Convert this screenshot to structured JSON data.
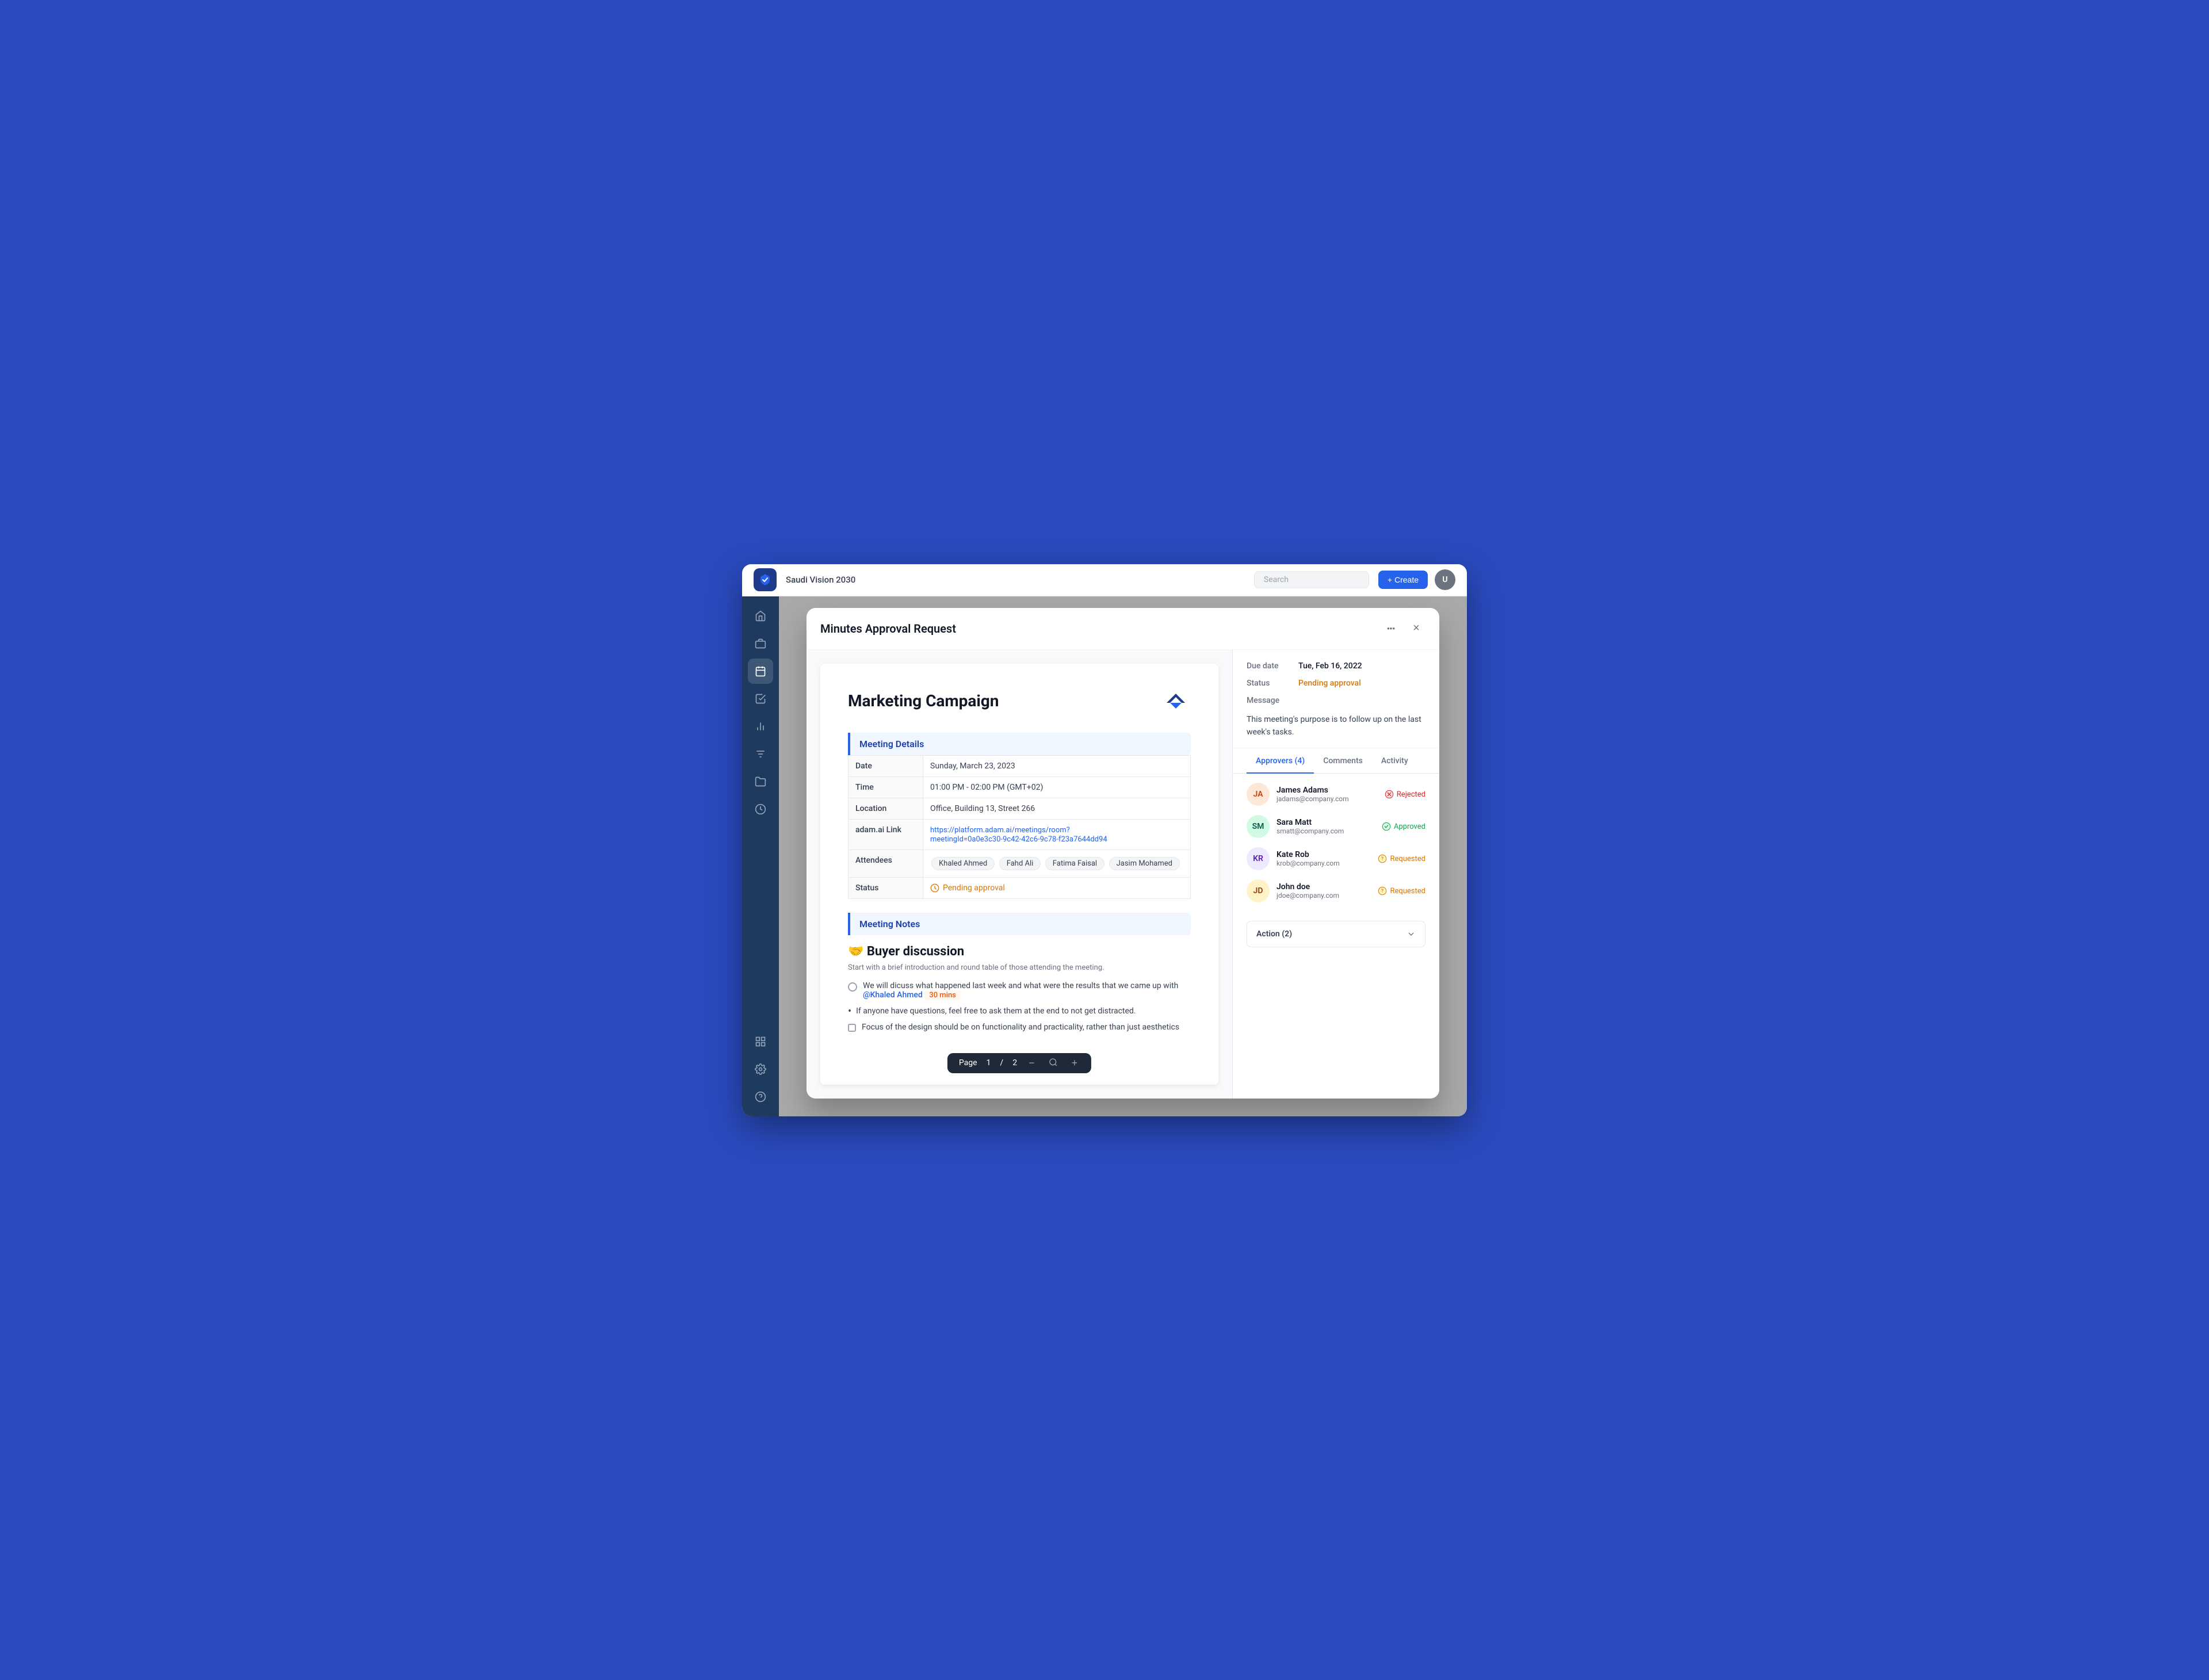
{
  "topbar": {
    "title": "Saudi Vision 2030",
    "search_placeholder": "Search",
    "create_label": "+ Create"
  },
  "modal": {
    "title": "Minutes Approval Request",
    "close_label": "×"
  },
  "document": {
    "title": "Marketing Campaign",
    "section_meeting_details": "Meeting Details",
    "fields": [
      {
        "label": "Date",
        "value": "Sunday, March 23, 2023"
      },
      {
        "label": "Time",
        "value": "01:00 PM - 02:00 PM (GMT+02)"
      },
      {
        "label": "Location",
        "value": "Office, Building 13, Street 266"
      },
      {
        "label": "adam.ai Link",
        "value": "https://platform.adam.ai/meetings/room?meetingId=0a0e3c30-9c42-42c6-9c78-f23a7644dd94",
        "is_link": true
      },
      {
        "label": "Attendees",
        "value": "",
        "is_attendees": true
      },
      {
        "label": "Status",
        "value": "Pending approval",
        "is_status": true
      }
    ],
    "attendees": [
      "Khaled Ahmed",
      "Fahd Ali",
      "Fatima Faisal",
      "Jasim Mohamed"
    ],
    "section_notes": "Meeting Notes",
    "notes_heading": "🤝 Buyer discussion",
    "notes_subtitle": "Start with a brief introduction and round table of those attending the meeting.",
    "tasks": [
      {
        "type": "circle",
        "text": "We will dicuss what happened last week and what were the results that we came up with",
        "mention": "@Khaled Ahmed",
        "time": "30 mins"
      }
    ],
    "bullet_items": [
      "If anyone have questions, feel free to ask them at the end to not get distracted."
    ],
    "checkbox_items": [
      "Focus of the design should be on functionality and practicality, rather than just aesthetics"
    ],
    "page_label": "Page",
    "page_current": "1",
    "page_separator": "/",
    "page_total": "2"
  },
  "panel": {
    "due_date_label": "Due date",
    "due_date_value": "Tue, Feb 16, 2022",
    "status_label": "Status",
    "status_value": "Pending approval",
    "message_label": "Message",
    "message_text": "This meeting's purpose is to follow up on the last week's tasks.",
    "tabs": [
      {
        "id": "approvers",
        "label": "Approvers (4)"
      },
      {
        "id": "comments",
        "label": "Comments"
      },
      {
        "id": "activity",
        "label": "Activity"
      }
    ],
    "active_tab": "approvers",
    "approvers": [
      {
        "name": "James Adams",
        "email": "jadams@company.com",
        "status": "Rejected",
        "status_type": "rejected",
        "initials": "JA",
        "avatar_class": "av-james"
      },
      {
        "name": "Sara Matt",
        "email": "smatt@company.com",
        "status": "Approved",
        "status_type": "approved",
        "initials": "SM",
        "avatar_class": "av-sara"
      },
      {
        "name": "Kate Rob",
        "email": "krob@company.com",
        "status": "Requested",
        "status_type": "requested",
        "initials": "KR",
        "avatar_class": "av-kate"
      },
      {
        "name": "John doe",
        "email": "jdoe@company.com",
        "status": "Requested",
        "status_type": "requested",
        "initials": "JD",
        "avatar_class": "av-john"
      }
    ],
    "action_label": "Action (2)"
  },
  "sidebar": {
    "items": [
      {
        "id": "home",
        "icon": "home",
        "active": false
      },
      {
        "id": "briefcase",
        "icon": "briefcase",
        "active": false
      },
      {
        "id": "calendar",
        "icon": "calendar",
        "active": true
      },
      {
        "id": "checkboard",
        "icon": "checkboard",
        "active": false
      },
      {
        "id": "chart",
        "icon": "chart",
        "active": false
      },
      {
        "id": "filter",
        "icon": "filter",
        "active": false
      },
      {
        "id": "folder",
        "icon": "folder",
        "active": false
      },
      {
        "id": "clock",
        "icon": "clock",
        "active": false
      }
    ],
    "bottom_items": [
      {
        "id": "grid",
        "icon": "grid"
      },
      {
        "id": "settings",
        "icon": "settings"
      },
      {
        "id": "help",
        "icon": "help"
      }
    ]
  }
}
